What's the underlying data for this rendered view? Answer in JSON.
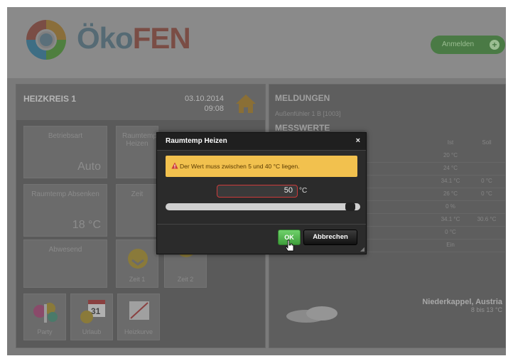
{
  "header": {
    "logo_oko": "Öko",
    "logo_fen": "FEN",
    "login_label": "Anmelden",
    "login_icon": "plus-icon"
  },
  "heizkreis": {
    "title": "HEIZKREIS 1",
    "date": "03.10.2014",
    "time": "09:08",
    "tiles": {
      "betriebsart_label": "Betriebsart",
      "betriebsart_value": "Auto",
      "raumtemp_label": "Raumtemp Heizen",
      "raumtemp_absenken_label": "Raumtemp Absenken",
      "raumtemp_absenken_value": "18 °C",
      "zeit_label": "Zeit",
      "zeit1_label": "Zeit 1",
      "zeit2_label": "Zeit 2",
      "party_label": "Party",
      "urlaub_label": "Urlaub",
      "heizkurve_label": "Heizkurve",
      "urlaub_calendar_day": "31"
    }
  },
  "meldungen": {
    "title": "MELDUNGEN",
    "item": "Außenfühler 1 B [1003]"
  },
  "messwerte": {
    "title": "MESSWERTE",
    "col_ist": "Ist",
    "col_soll": "Soll",
    "rows": [
      {
        "ist": "20 °C",
        "soll": ""
      },
      {
        "ist": "24 °C",
        "soll": ""
      },
      {
        "ist": "34.1 °C",
        "soll": "0 °C"
      },
      {
        "ist": "26 °C",
        "soll": "0 °C"
      },
      {
        "ist": "0 %",
        "soll": ""
      },
      {
        "ist": "34.1 °C",
        "soll": "30.6 °C"
      },
      {
        "ist": "0 °C",
        "soll": ""
      },
      {
        "ist": "Ein",
        "soll": ""
      }
    ]
  },
  "weather": {
    "city": "Niederkappel, Austria",
    "range": "8 bis 13 °C"
  },
  "dialog": {
    "title": "Raumtemp Heizen",
    "close": "×",
    "alert_text": "Der Wert muss zwischen 5 und 40 °C liegen.",
    "input_value": "50",
    "unit": "°C",
    "ok_label": "OK",
    "cancel_label": "Abbrechen",
    "slider_value_fraction": 0.96
  },
  "colors": {
    "alert_bg": "#f2c14e",
    "ok_green": "#4fb84b",
    "input_error_border": "#cc3b3b"
  }
}
